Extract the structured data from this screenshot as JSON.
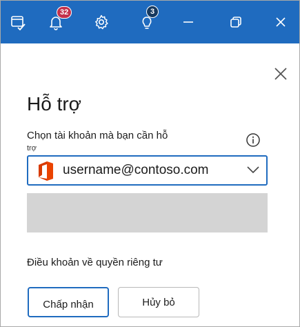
{
  "titlebar": {
    "notifications_count": "32",
    "tips_count": "3",
    "colors": {
      "background": "#1f6bbf",
      "badge_red": "#c4314b",
      "badge_dark": "#16395f"
    },
    "icons": [
      "tasks-icon",
      "bell-icon",
      "gear-icon",
      "lightbulb-icon",
      "minimize-icon",
      "restore-icon",
      "close-icon"
    ]
  },
  "panel": {
    "title": "Hỗ trợ",
    "select_label": "Chọn tài khoản mà bạn cần hỗ",
    "select_label_wrap": "trợ",
    "account": {
      "value": "username@contoso.com",
      "icon": "office-logo-icon"
    },
    "privacy_link": "Điều khoản về quyền riêng tư",
    "accept_label": "Chấp nhận",
    "cancel_label": "Hủy bỏ"
  }
}
